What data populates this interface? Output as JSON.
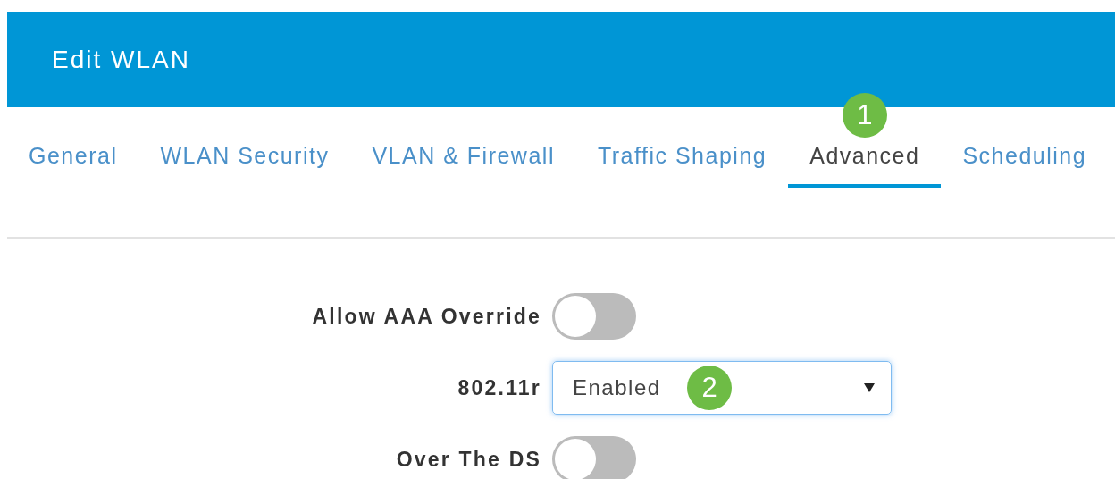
{
  "header": {
    "title": "Edit WLAN"
  },
  "tabs": [
    {
      "label": "General",
      "selected": false
    },
    {
      "label": "WLAN Security",
      "selected": false
    },
    {
      "label": "VLAN & Firewall",
      "selected": false
    },
    {
      "label": "Traffic Shaping",
      "selected": false
    },
    {
      "label": "Advanced",
      "selected": true,
      "callout": "1"
    },
    {
      "label": "Scheduling",
      "selected": false
    }
  ],
  "fields": [
    {
      "kind": "toggle",
      "label": "Allow AAA Override",
      "on": false
    },
    {
      "kind": "select",
      "label": "802.11r",
      "value": "Enabled",
      "focused": true,
      "callout": "2"
    },
    {
      "kind": "toggle",
      "label": "Over The DS",
      "on": false
    }
  ]
}
